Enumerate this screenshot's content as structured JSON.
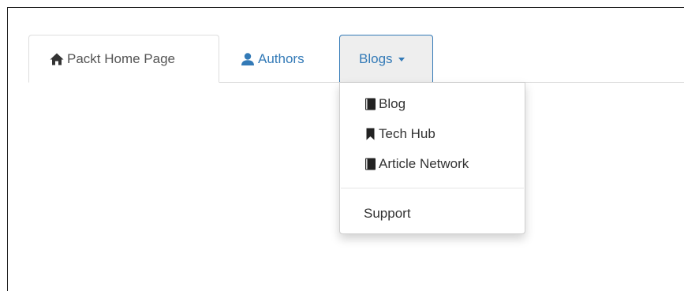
{
  "tabs": {
    "home": {
      "label": "Packt Home Page",
      "icon": "home-icon"
    },
    "authors": {
      "label": "Authors",
      "icon": "user-icon"
    },
    "blogs": {
      "label": "Blogs",
      "icon": "caret-down-icon"
    }
  },
  "dropdown": {
    "items": [
      {
        "label": "Blog",
        "icon": "book-icon"
      },
      {
        "label": "Tech Hub",
        "icon": "bookmark-icon"
      },
      {
        "label": "Article Network",
        "icon": "book-icon"
      }
    ],
    "footer_item": {
      "label": "Support"
    }
  },
  "colors": {
    "link": "#337ab7",
    "active_tab_text": "#555555",
    "border": "#dddddd",
    "open_tab_bg": "#eeeeee"
  }
}
